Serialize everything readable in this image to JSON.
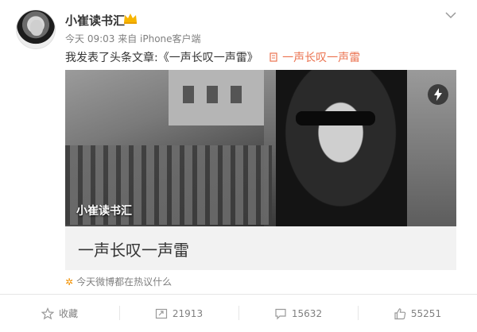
{
  "post": {
    "username": "小崔读书汇",
    "meta": "今天 09:03 来自 iPhone客户端",
    "text_prefix": "我发表了头条文章:",
    "text_title": "《一声长叹一声雷》",
    "link_text": "一声长叹一声雷",
    "cover_caption": "小崔读书汇",
    "card_title": "一声长叹一声雷",
    "hot_text": "今天微博都在热议什么"
  },
  "actions": {
    "favorite_label": "收藏",
    "repost_count": "21913",
    "comment_count": "15632",
    "like_count": "55251"
  },
  "icons": [
    "avatar",
    "vip-icon",
    "chevron-down-icon",
    "link-icon",
    "flash-icon",
    "star-icon",
    "favorite-icon",
    "repost-icon",
    "comment-icon",
    "like-icon"
  ],
  "colors": {
    "link": "#eb7350",
    "meta": "#808080",
    "hot_star": "#f29100"
  }
}
